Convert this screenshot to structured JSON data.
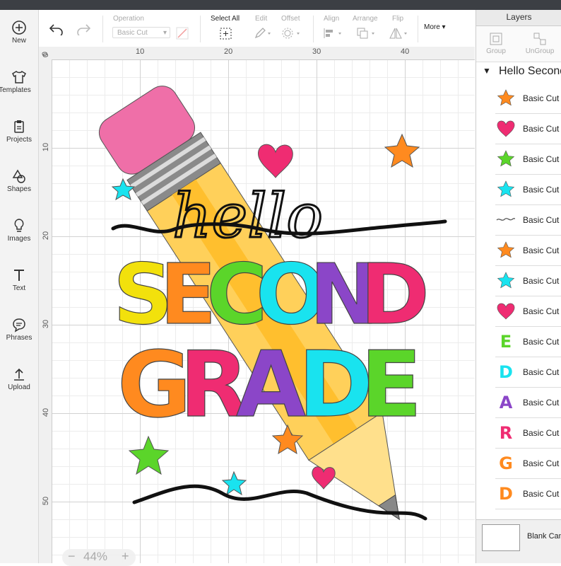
{
  "sidebar": {
    "items": [
      {
        "label": "New",
        "icon": "plus-circle-icon"
      },
      {
        "label": "Templates",
        "icon": "tshirt-icon"
      },
      {
        "label": "Projects",
        "icon": "clipboard-icon"
      },
      {
        "label": "Shapes",
        "icon": "shapes-icon"
      },
      {
        "label": "Images",
        "icon": "lightbulb-icon"
      },
      {
        "label": "Text",
        "icon": "text-t-icon"
      },
      {
        "label": "Phrases",
        "icon": "speech-bubble-icon"
      },
      {
        "label": "Upload",
        "icon": "upload-arrow-icon"
      }
    ]
  },
  "toolbar": {
    "operation_label": "Operation",
    "operation_value": "Basic Cut",
    "select_all_label": "Select All",
    "edit_label": "Edit",
    "offset_label": "Offset",
    "align_label": "Align",
    "arrange_label": "Arrange",
    "flip_label": "Flip",
    "more_label": "More ▾"
  },
  "ruler": {
    "top": [
      "10",
      "20",
      "30",
      "40"
    ],
    "top_zero": "0",
    "left": [
      "10",
      "20",
      "30",
      "40",
      "50"
    ],
    "left_zero": "0"
  },
  "canvas": {
    "hello_text": "hello",
    "line1": "SECOND",
    "line2": "GRADE",
    "line1_colors": [
      "#f2e10c",
      "#ff8a1f",
      "#5bd52a",
      "#19e3ef",
      "#8b46c8",
      "#ef2c72",
      "#ff8a1f"
    ],
    "line2_colors": [
      "#ff8a1f",
      "#ef2c72",
      "#8b46c8",
      "#19e3ef",
      "#5bd52a"
    ]
  },
  "zoom": {
    "minus": "−",
    "value": "44%",
    "plus": "+"
  },
  "layers": {
    "title": "Layers",
    "group_label": "Group",
    "ungroup_label": "UnGroup",
    "group_name": "Hello Second Grade",
    "rows": [
      {
        "type": "star",
        "color": "#ff8a1f",
        "label": "Basic Cut"
      },
      {
        "type": "heart",
        "color": "#ef2c72",
        "label": "Basic Cut"
      },
      {
        "type": "star",
        "color": "#5bd52a",
        "label": "Basic Cut"
      },
      {
        "type": "star",
        "color": "#19e3ef",
        "label": "Basic Cut"
      },
      {
        "type": "squiggle",
        "color": "#555555",
        "label": "Basic Cut"
      },
      {
        "type": "star",
        "color": "#ff8a1f",
        "label": "Basic Cut"
      },
      {
        "type": "star",
        "color": "#19e3ef",
        "label": "Basic Cut"
      },
      {
        "type": "heart",
        "color": "#ef2c72",
        "label": "Basic Cut"
      },
      {
        "type": "letter",
        "letter": "E",
        "color": "#5bd52a",
        "label": "Basic Cut"
      },
      {
        "type": "letter",
        "letter": "D",
        "color": "#19e3ef",
        "label": "Basic Cut"
      },
      {
        "type": "letter",
        "letter": "A",
        "color": "#8b46c8",
        "label": "Basic Cut"
      },
      {
        "type": "letter",
        "letter": "R",
        "color": "#ef2c72",
        "label": "Basic Cut"
      },
      {
        "type": "letter",
        "letter": "G",
        "color": "#ff8a1f",
        "label": "Basic Cut"
      },
      {
        "type": "letter",
        "letter": "D",
        "color": "#ff8a1f",
        "label": "Basic Cut"
      }
    ],
    "blank_canvas_label": "Blank Canvas"
  }
}
